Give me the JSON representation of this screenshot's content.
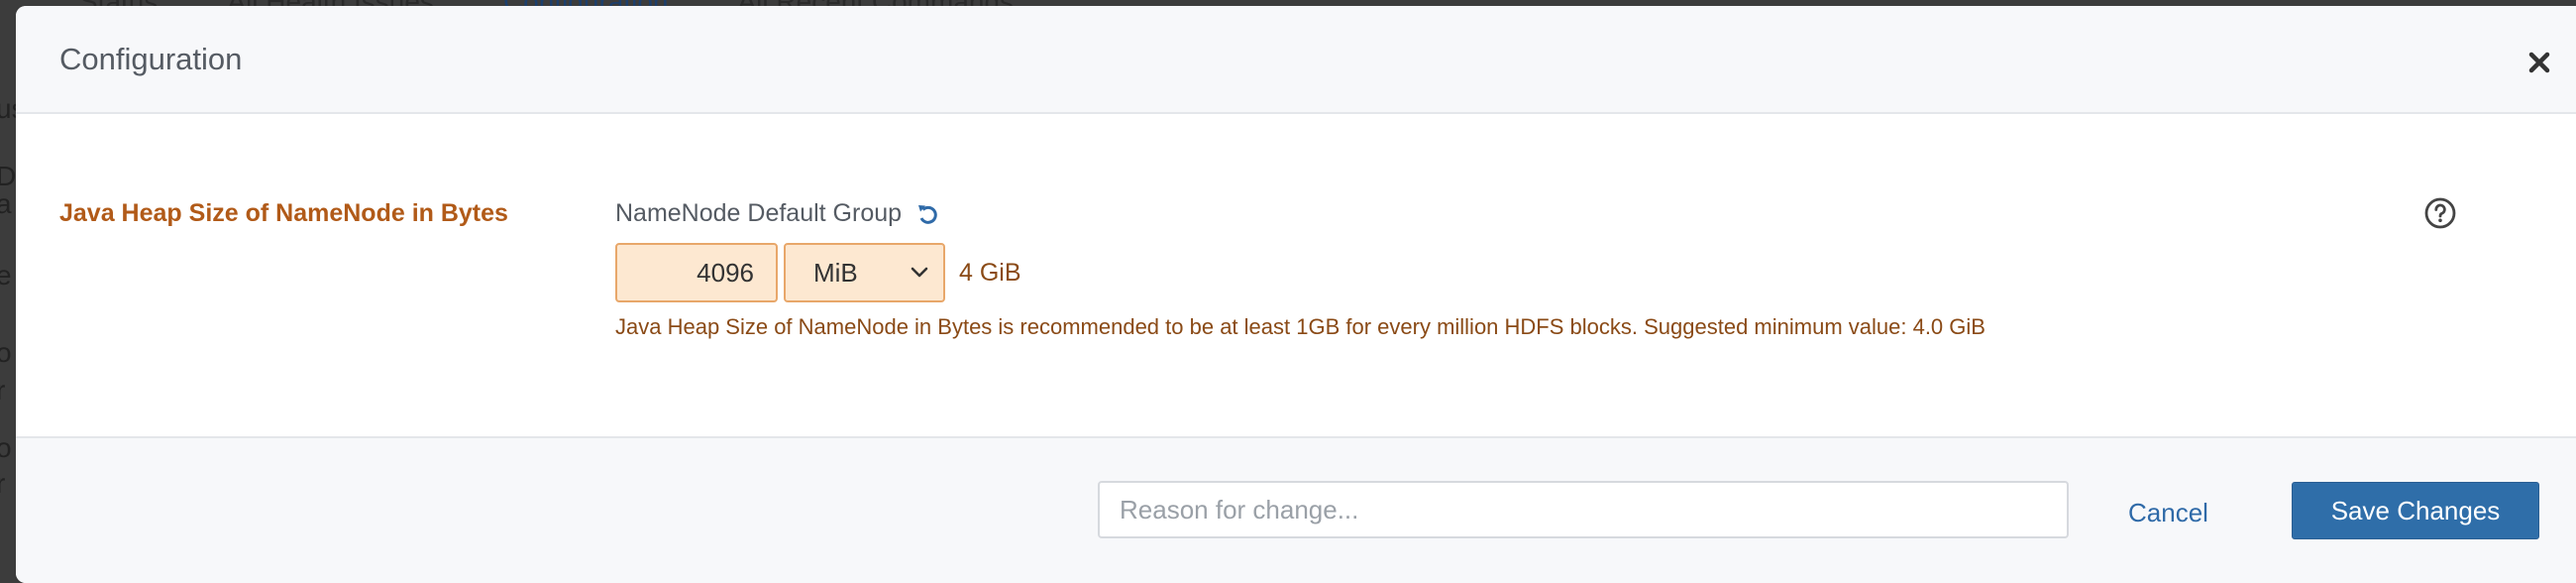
{
  "background": {
    "tabs": [
      "Status",
      "All Health Issues",
      "Configuration",
      "All Recent Commands"
    ],
    "left_fragments": [
      "us",
      "D",
      "a",
      "e",
      "o",
      "r",
      "o",
      "r"
    ]
  },
  "modal": {
    "title": "Configuration",
    "close_icon": "close-icon"
  },
  "property": {
    "label": "Java Heap Size of NameNode in Bytes",
    "group_name": "NameNode Default Group",
    "reset_icon": "undo-icon",
    "help_icon": "question-circle-icon",
    "value": "4096",
    "unit": "MiB",
    "unit_options": [
      "MiB"
    ],
    "converted": "4 GiB",
    "warning": "Java Heap Size of NameNode in Bytes is recommended to be at least 1GB for every million HDFS blocks. Suggested minimum value: 4.0 GiB"
  },
  "footer": {
    "reason_placeholder": "Reason for change...",
    "cancel_label": "Cancel",
    "save_label": "Save Changes"
  },
  "colors": {
    "warning_text": "#8a4a16",
    "label_text": "#b15a18",
    "input_bg": "#fde8d1",
    "input_border": "#e8a76a",
    "primary": "#2f6ea9",
    "link": "#2f6aa8"
  }
}
